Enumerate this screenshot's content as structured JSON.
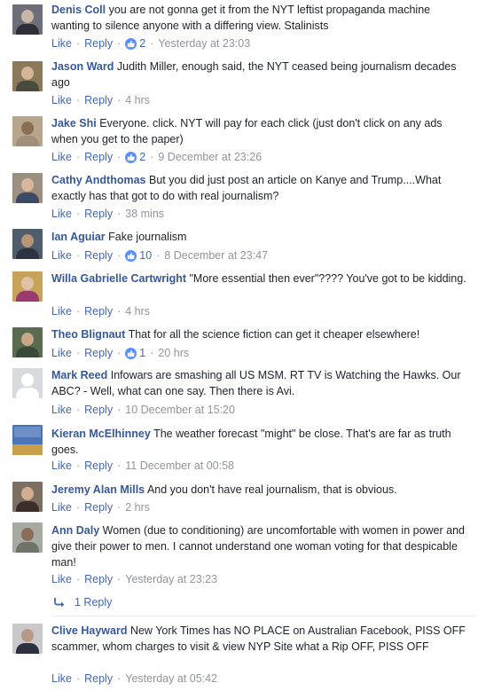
{
  "ui": {
    "like_label": "Like",
    "reply_label": "Reply",
    "separator": "·"
  },
  "comments": [
    {
      "name": "Denis Coll",
      "text": "you are not gonna get it from the NYT leftist propaganda machine wanting to silence anyone with a differing view. Stalinists",
      "likes": "2",
      "time": "Yesterday at 23:03",
      "avatar_bg": "#6d6f78"
    },
    {
      "name": "Jason Ward",
      "text": "Judith Miller, enough said, the NYT ceased being journalism decades ago",
      "likes": "",
      "time": "4 hrs",
      "avatar_bg": "#8b7a5a"
    },
    {
      "name": "Jake Shi",
      "text": "Everyone. click. NYT will pay for each click (just don't click on any ads when you get to the paper)",
      "likes": "2",
      "time": "9 December at 23:26",
      "avatar_bg": "#b8a68c"
    },
    {
      "name": "Cathy Andthomas",
      "text": "But you did just post an article on Kanye and Trump....What exactly has that got to do with real journalism?",
      "likes": "",
      "time": "38 mins",
      "avatar_bg": "#9c8f7f"
    },
    {
      "name": "Ian Aguiar",
      "text": "Fake journalism",
      "likes": "10",
      "time": "8 December at 23:47",
      "avatar_bg": "#4e5d6c"
    },
    {
      "name": "Willa Gabrielle Cartwright",
      "text": "\"More essential then ever\"???? You've got to be kidding.",
      "likes": "",
      "time": "4 hrs",
      "avatar_bg": "#c7a35a"
    },
    {
      "name": "Theo Blignaut",
      "text": "That for all the science fiction can get it cheaper elsewhere!",
      "likes": "1",
      "time": "20 hrs",
      "avatar_bg": "#5a6b4f"
    },
    {
      "name": "Mark Reed",
      "text": "Infowars are smashing all US MSM. RT TV is Watching the Hawks. Our ABC? - Well, what can one say. Then there is Avi.",
      "likes": "",
      "time": "10 December at 15:20",
      "avatar_bg": "#d8dade"
    },
    {
      "name": "Kieran McElhinney",
      "text": "The weather forecast \"might\" be close. That's are far as truth goes.",
      "likes": "",
      "time": "11 December at 00:58",
      "avatar_bg": "#4a74b8"
    },
    {
      "name": "Jeremy Alan Mills",
      "text": "And you don't have real journalism, that is obvious.",
      "likes": "",
      "time": "2 hrs",
      "avatar_bg": "#7d6e62"
    },
    {
      "name": "Ann Daly",
      "text": "Women (due to conditioning) are uncomfortable with women in power and give their power to men. I cannot understand one woman voting for that despicable man!",
      "likes": "",
      "time": "Yesterday at 23:23",
      "avatar_bg": "#a7a9a3"
    },
    {
      "name": "Clive Hayward",
      "text": "New York Times has NO PLACE on Australian Facebook, PISS OFF scammer, whom charges to visit & view NYP Site what a Rip OFF, PISS OFF",
      "likes": "",
      "time": "Yesterday at 05:42",
      "avatar_bg": "#c9c9cc"
    }
  ],
  "reply_thread": {
    "label": "1 Reply"
  },
  "colors": {
    "name": "#365899",
    "link": "#4267b2",
    "meta": "#90949c",
    "like_badge": "#5890ff"
  }
}
